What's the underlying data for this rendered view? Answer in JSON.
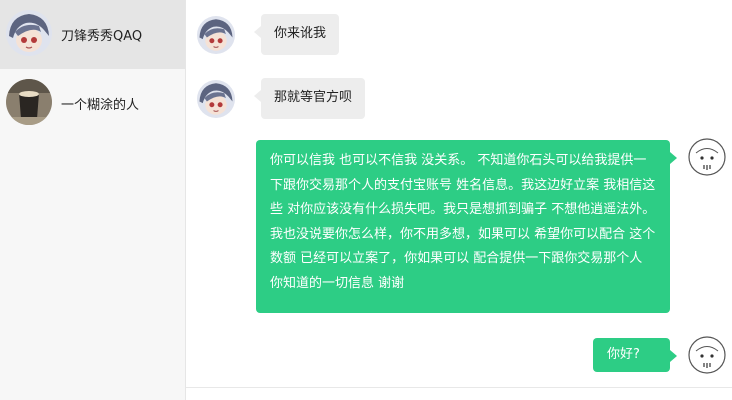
{
  "sidebar": {
    "contacts": [
      {
        "name": "刀锋秀秀QAQ",
        "active": true
      },
      {
        "name": "一个糊涂的人",
        "active": false
      }
    ]
  },
  "chat": {
    "messages": [
      {
        "side": "left",
        "text": "你来讹我"
      },
      {
        "side": "left",
        "text": "那就等官方呗"
      },
      {
        "side": "right",
        "text": "你可以信我 也可以不信我 没关系。 不知道你石头可以给我提供一下跟你交易那个人的支付宝账号 姓名信息。我这边好立案 我相信这些 对你应该没有什么损失吧。我只是想抓到骗子 不想他逍遥法外。 我也没说要你怎么样，你不用多想，如果可以 希望你可以配合 这个数额 已经可以立案了，你如果可以 配合提供一下跟你交易那个人 你知道的一切信息 谢谢"
      },
      {
        "side": "right",
        "text": "你好?"
      }
    ]
  },
  "colors": {
    "sent_bubble": "#2dcd85",
    "received_bubble": "#ededed",
    "active_contact": "#e5e5e5"
  }
}
